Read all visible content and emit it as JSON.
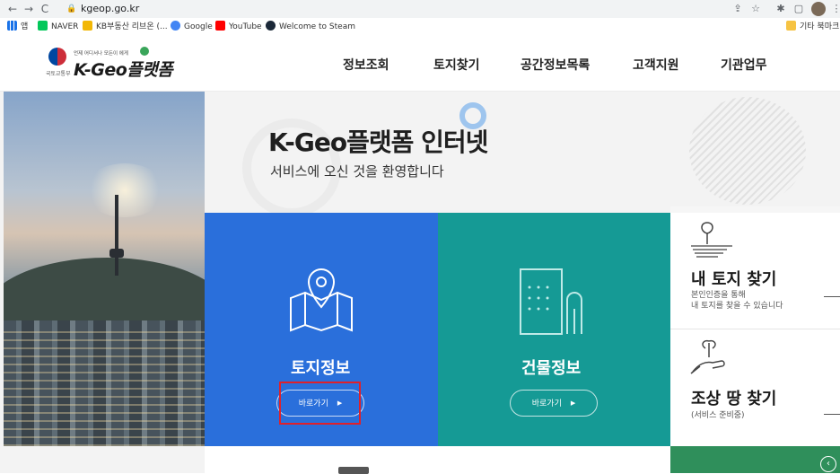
{
  "browser": {
    "url": "kgeop.go.kr",
    "back_icon": "arrow-left-icon",
    "forward_icon": "arrow-right-icon",
    "reload_icon": "reload-icon"
  },
  "bookmarks": {
    "apps_label": "앱",
    "items": [
      {
        "label": "NAVER",
        "color": "#03c75a"
      },
      {
        "label": "KB부동산 리브온 (...",
        "color": "#f2b705"
      },
      {
        "label": "Google",
        "color": "#4285f4"
      },
      {
        "label": "YouTube",
        "color": "#ff0000"
      },
      {
        "label": "Welcome to Steam",
        "color": "#1b2838"
      }
    ],
    "other_label": "기타 북마크"
  },
  "site": {
    "logo": {
      "tagline": "언제 어디서나 모든이 에게",
      "ministry": "국토교통부",
      "name": "K-Geo플랫폼"
    },
    "nav": [
      "정보조회",
      "토지찾기",
      "공간정보목록",
      "고객지원",
      "기관업무"
    ]
  },
  "hero": {
    "title": "K-Geo플랫폼 인터넷",
    "subtitle": "서비스에 오신 것을 환영합니다"
  },
  "cards": {
    "land": {
      "title": "토지정보",
      "button": "바로가기",
      "color": "#2a6fdb"
    },
    "building": {
      "title": "건물정보",
      "button": "바로가기",
      "color": "#159a95"
    }
  },
  "side": {
    "my_land": {
      "title": "내 토지 찾기",
      "desc_line1": "본인인증을 통해",
      "desc_line2": "내 토지를 찾을 수 있습니다"
    },
    "ancestor_land": {
      "title": "조상 땅 찾기",
      "desc_line1": "(서비스 준비중)"
    }
  },
  "highlight_color": "#e0202a"
}
